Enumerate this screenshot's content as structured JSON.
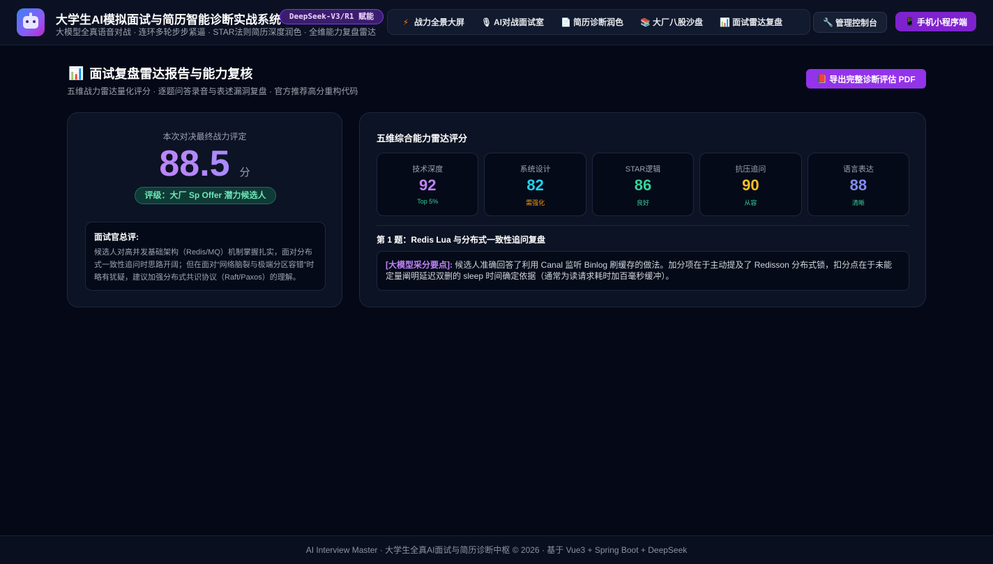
{
  "header": {
    "title": "大学生AI模拟面试与简历智能诊断实战系统",
    "model_badge": "DeepSeek-V3/R1 赋能",
    "subtitle": "大模型全真语音对战 · 连环多轮步步紧逼 · STAR法则简历深度润色 · 全维能力复盘雷达",
    "nav": [
      {
        "label": "战力全景大屏",
        "icon": "lightning-icon",
        "glyph": "⚡",
        "color": "#f97316"
      },
      {
        "label": "AI对战面试室",
        "icon": "microphone-icon",
        "glyph": "🎙",
        "color": "#e5e7eb"
      },
      {
        "label": "简历诊断润色",
        "icon": "document-icon",
        "glyph": "📄",
        "color": "#e5e7eb"
      },
      {
        "label": "大厂八股沙盘",
        "icon": "books-icon",
        "glyph": "📚",
        "color": "#e5e7eb"
      },
      {
        "label": "面试雷达复盘",
        "icon": "bar-chart-icon",
        "glyph": "📊",
        "color": "#e5e7eb"
      }
    ],
    "admin_label": "管理控制台",
    "admin_glyph": "🔧",
    "mini_label": "手机小程序端",
    "mini_glyph": "📱"
  },
  "page": {
    "title": "面试复盘雷达报告与能力复核",
    "title_glyph": "📊",
    "subtitle": "五维战力雷达量化评分 · 逐题问答录音与表述漏洞复盘 · 官方推荐高分重构代码",
    "export_label": "导出完整诊断评估 PDF",
    "export_glyph": "📕"
  },
  "score_card": {
    "caption": "本次对决最终战力评定",
    "score": "88.5",
    "unit": "分",
    "grade": "评级：大厂 Sp Offer 潜力候选人",
    "summary_title": "面试官总评:",
    "summary_text": "候选人对高并发基础架构（Redis/MQ）机制掌握扎实，面对分布式一致性追问时思路开阔；但在面对“网络脑裂与极端分区容错”时略有犹疑，建议加强分布式共识协议（Raft/Paxos）的理解。"
  },
  "radar_card": {
    "title": "五维综合能力雷达评分",
    "metrics": [
      {
        "label": "技术深度",
        "value": "92",
        "tag": "Top 5%",
        "color": "#c084fc",
        "tag_color": "#34d399"
      },
      {
        "label": "系统设计",
        "value": "82",
        "tag": "需强化",
        "color": "#22d3ee",
        "tag_color": "#f59e0b"
      },
      {
        "label": "STAR逻辑",
        "value": "86",
        "tag": "良好",
        "color": "#34d399",
        "tag_color": "#34d399"
      },
      {
        "label": "抗压追问",
        "value": "90",
        "tag": "从容",
        "color": "#fbbf24",
        "tag_color": "#34d399"
      },
      {
        "label": "语言表达",
        "value": "88",
        "tag": "清晰",
        "color": "#818cf8",
        "tag_color": "#34d399"
      }
    ],
    "question_title": "第 1 题：Redis Lua 与分布式一致性追问复盘",
    "question_key": "[大模型采分要点]:",
    "question_text": "候选人准确回答了利用 Canal 监听 Binlog 刷缓存的做法。加分项在于主动提及了 Redisson 分布式锁，扣分点在于未能定量阐明延迟双删的 sleep 时间确定依据（通常为读请求耗时加百毫秒缓冲）。"
  },
  "footer": {
    "text": "AI Interview Master · 大学生全真AI面试与简历诊断中枢 © 2026 · 基于 Vue3 + Spring Boot + DeepSeek"
  }
}
